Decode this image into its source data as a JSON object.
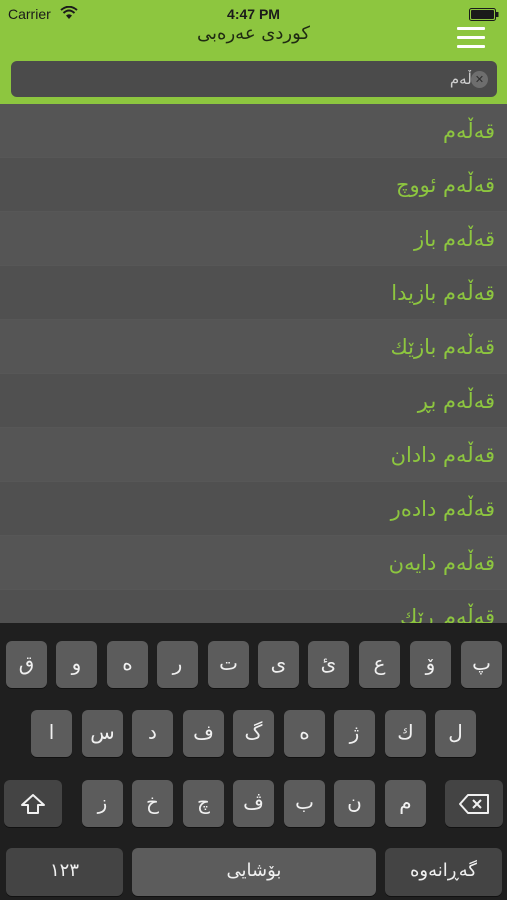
{
  "status": {
    "carrier": "Carrier",
    "time": "4:47 PM"
  },
  "header": {
    "title": "کوردی عەرەبی"
  },
  "search": {
    "value": "قەڵەم"
  },
  "results": [
    "قەڵەم",
    "قەڵەم ئووچ",
    "قەڵەم باز",
    "قەڵەم بازیدا",
    "قەڵەم بازێك",
    "قەڵەم بڕ",
    "قەڵەم دادان",
    "قەڵەم دادەر",
    "قەڵەم دایەن",
    "قەڵەم ڕێك"
  ],
  "keyboard": {
    "row1": [
      "پ",
      "ۆ",
      "ع",
      "ئ",
      "ی",
      "ت",
      "ر",
      "ە",
      "و",
      "ق"
    ],
    "row2": [
      "ل",
      "ك",
      "ژ",
      "ه",
      "گ",
      "ف",
      "د",
      "س",
      "ا"
    ],
    "row3": [
      "م",
      "ن",
      "ب",
      "ڤ",
      "چ",
      "خ",
      "ز"
    ],
    "numbers_label": "١٢٣",
    "space_label": "بۆشایی",
    "return_label": "گەڕانەوە"
  }
}
